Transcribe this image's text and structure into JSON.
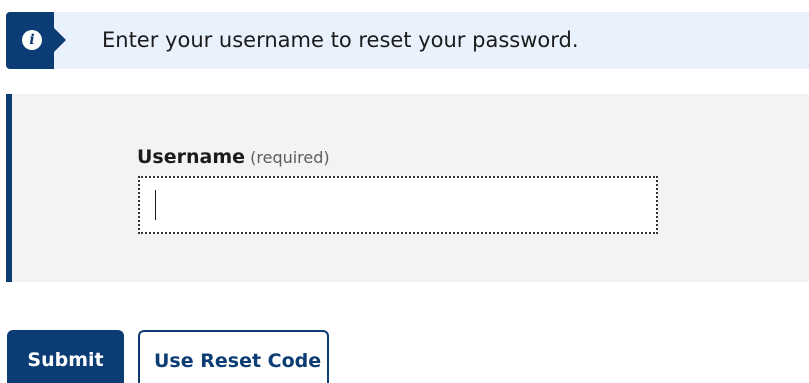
{
  "info_banner": {
    "icon": "info-icon",
    "icon_glyph": "i",
    "message": "Enter your username to reset your password."
  },
  "form": {
    "username": {
      "label": "Username",
      "hint": "(required)",
      "value": "",
      "placeholder": ""
    }
  },
  "actions": {
    "submit_label": "Submit",
    "reset_code_label": "Use Reset Code"
  },
  "colors": {
    "primary": "#0b3c74",
    "banner_bg": "#e8f1fc",
    "panel_bg": "#f3f3f3"
  }
}
